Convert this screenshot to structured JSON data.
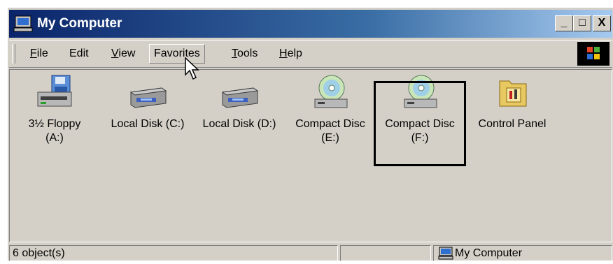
{
  "window": {
    "title": "My Computer",
    "buttons": {
      "minimize": "_",
      "maximize": "□",
      "close": "X"
    }
  },
  "menu": [
    {
      "label_u": "F",
      "label_rest": "ile"
    },
    {
      "label_u": "",
      "label_rest": "Edit"
    },
    {
      "label_u": "V",
      "label_rest": "iew"
    },
    {
      "label_u": "",
      "label_rest": "Favorites"
    },
    {
      "label_u": "T",
      "label_rest": "ools"
    },
    {
      "label_u": "H",
      "label_rest": "elp"
    }
  ],
  "items": [
    {
      "line1": "3½ Floppy",
      "line2": "(A:)",
      "icon": "floppy-drive-icon"
    },
    {
      "line1": "Local Disk (C:)",
      "line2": "",
      "icon": "hard-disk-icon"
    },
    {
      "line1": "Local Disk (D:)",
      "line2": "",
      "icon": "hard-disk-icon"
    },
    {
      "line1": "Compact Disc",
      "line2": "(E:)",
      "icon": "cd-drive-icon"
    },
    {
      "line1": "Compact Disc",
      "line2": "(F:)",
      "icon": "cd-drive-icon"
    },
    {
      "line1": "Control Panel",
      "line2": "",
      "icon": "control-panel-icon"
    }
  ],
  "status": {
    "objects": "6 object(s)",
    "location": "My Computer"
  }
}
